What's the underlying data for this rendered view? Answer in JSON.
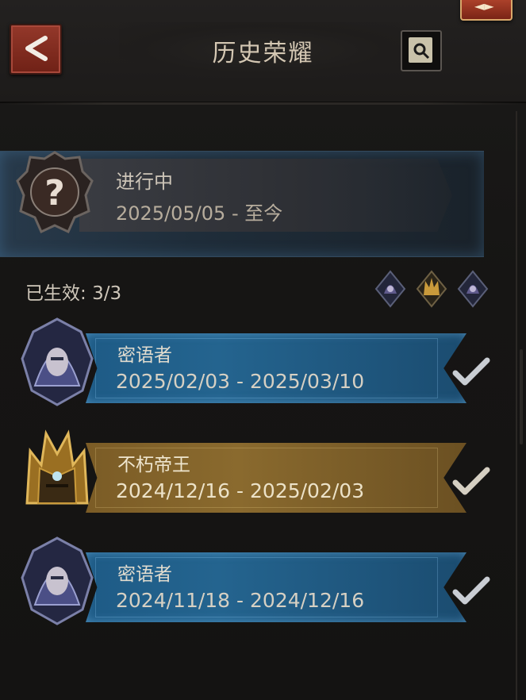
{
  "header": {
    "title": "历史荣耀",
    "back_icon": "back-arrow-icon",
    "search_icon": "record-search-icon"
  },
  "current": {
    "status": "进行中",
    "dates": "2025/05/05 - 至今",
    "emblem_icon": "unknown-question-icon"
  },
  "effective": {
    "label": "已生效:",
    "count": "3/3",
    "mini_emblems": [
      "whisperer-mini-icon",
      "emperor-mini-icon",
      "whisperer-mini-icon"
    ]
  },
  "history": [
    {
      "name": "密语者",
      "dates": "2025/02/03 - 2025/03/10",
      "style": "blue",
      "emblem_icon": "hooded-whisperer-icon",
      "completed": true
    },
    {
      "name": "不朽帝王",
      "dates": "2024/12/16 - 2025/02/03",
      "style": "gold",
      "emblem_icon": "golden-emperor-icon",
      "completed": true
    },
    {
      "name": "密语者",
      "dates": "2024/11/18 - 2024/12/16",
      "style": "blue",
      "emblem_icon": "hooded-whisperer-icon",
      "completed": true
    }
  ],
  "colors": {
    "blue_ribbon": "#24648f",
    "gold_ribbon": "#8a6a2e",
    "back_button": "#94382a"
  }
}
